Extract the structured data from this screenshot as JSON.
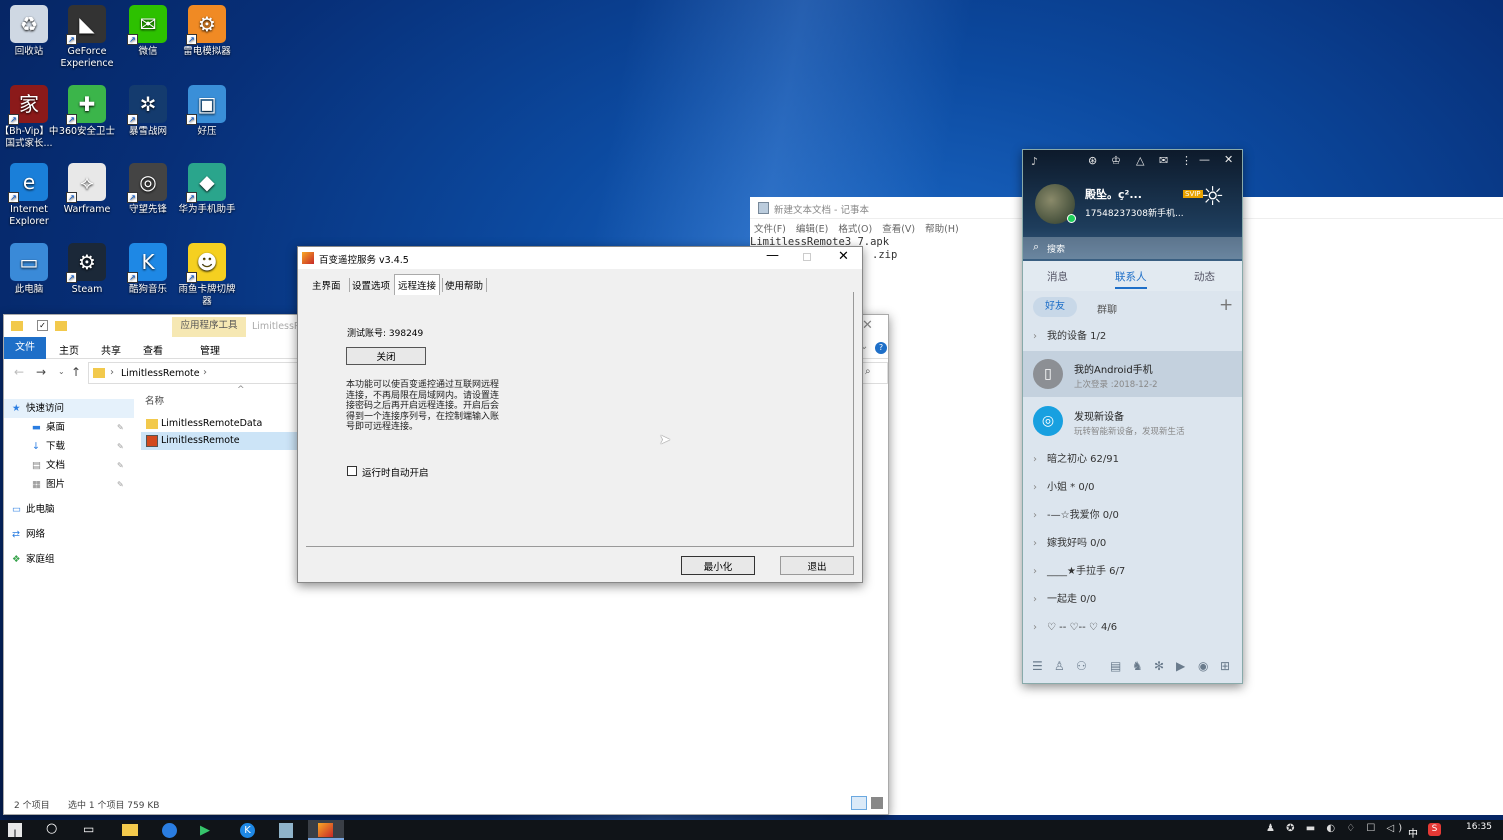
{
  "desktop": {
    "icons": [
      {
        "label": "回收站",
        "icon": "recycle-bin-icon",
        "bg": "#cfd8e3",
        "glyph": "♻"
      },
      {
        "label": "GeForce Experience",
        "icon": "geforce-icon",
        "bg": "#333333",
        "glyph": "◣"
      },
      {
        "label": "微信",
        "icon": "wechat-icon",
        "bg": "#2dc100",
        "glyph": "✉"
      },
      {
        "label": "雷电模拟器",
        "icon": "ldplayer-icon",
        "bg": "#f08a24",
        "glyph": "⚙"
      },
      {
        "label": "【Bh-Vip】中国式家长...",
        "icon": "game-icon",
        "bg": "#8b1a1a",
        "glyph": "家"
      },
      {
        "label": "360安全卫士",
        "icon": "360-icon",
        "bg": "#3bb54a",
        "glyph": "✚"
      },
      {
        "label": "暴雪战网",
        "icon": "battlenet-icon",
        "bg": "#143b6e",
        "glyph": "✲"
      },
      {
        "label": "好压",
        "icon": "haozip-icon",
        "bg": "#3a8fd8",
        "glyph": "▣"
      },
      {
        "label": "Internet Explorer",
        "icon": "ie-icon",
        "bg": "#1a7fd9",
        "glyph": "e"
      },
      {
        "label": "Warframe",
        "icon": "warframe-icon",
        "bg": "#e8e8e8",
        "glyph": "⟡"
      },
      {
        "label": "守望先锋",
        "icon": "overwatch-icon",
        "bg": "#444444",
        "glyph": "◎"
      },
      {
        "label": "华为手机助手",
        "icon": "hisuite-icon",
        "bg": "#2aa58c",
        "glyph": "◆"
      },
      {
        "label": "此电脑",
        "icon": "this-pc-icon",
        "bg": "#3a8ad8",
        "glyph": "▭"
      },
      {
        "label": "Steam",
        "icon": "steam-icon",
        "bg": "#1b2838",
        "glyph": "⚙"
      },
      {
        "label": "酷狗音乐",
        "icon": "kugou-icon",
        "bg": "#1e88e5",
        "glyph": "K"
      },
      {
        "label": "雨鱼卡牌切牌器",
        "icon": "pikachu-icon",
        "bg": "#f5d020",
        "glyph": "☻"
      }
    ]
  },
  "notepad": {
    "title": "新建文本文档 - 记事本",
    "menu": [
      "文件(F)",
      "编辑(E)",
      "格式(O)",
      "查看(V)",
      "帮助(H)"
    ],
    "line1": "LimitlessRemote3_7.apk",
    "line2": ".zip"
  },
  "explorer": {
    "ribbon_tabs": [
      "文件",
      "主页",
      "共享",
      "查看"
    ],
    "context_tab": "应用程序工具",
    "context_sub": "管理",
    "title_partial": "LimitlessR",
    "path": "LimitlessRemote",
    "nav": [
      {
        "label": "快速访问",
        "header": true
      },
      {
        "label": "桌面",
        "pin": true
      },
      {
        "label": "下载",
        "pin": true
      },
      {
        "label": "文档",
        "pin": true
      },
      {
        "label": "图片",
        "pin": true
      },
      {
        "label": "此电脑",
        "header": true
      },
      {
        "label": "网络",
        "header": true
      },
      {
        "label": "家庭组",
        "header": true
      }
    ],
    "col_name": "名称",
    "files": [
      {
        "name": "LimitlessRemoteData",
        "type": "folder"
      },
      {
        "name": "LimitlessRemote",
        "type": "app"
      }
    ],
    "status_count": "2 个项目",
    "status_sel": "选中 1 个项目 759 KB"
  },
  "dialog": {
    "title": "百变遥控服务 v3.4.5",
    "tabs": [
      "主界面",
      "设置选项",
      "远程连接",
      "使用帮助"
    ],
    "active_tab": 2,
    "account": "测试账号: 398249",
    "close_btn": "关闭",
    "desc": "本功能可以使百变遥控通过互联网远程连接，不再局限在局域网内。请设置连接密码之后再开启远程连接。开启后会得到一个连接序列号，在控制端输入账号即可远程连接。",
    "checkbox": "运行时自动开启",
    "minimize": "最小化",
    "exit": "退出"
  },
  "qq": {
    "nickname": "殿坠。ç²...",
    "vip": "SVIP",
    "sign": "17548237308新手机...",
    "search": "搜索",
    "tabs": [
      "消息",
      "联系人",
      "动态"
    ],
    "active_tab": 1,
    "subtabs": [
      "好友",
      "群聊"
    ],
    "devices_header": "我的设备 1/2",
    "device1_name": "我的Android手机",
    "device1_sub": "上次登录 :2018-12-2",
    "device2_name": "发现新设备",
    "device2_sub": "玩转智能新设备，发现新生活",
    "groups": [
      "暗之初心 62/91",
      "小姐 * 0/0",
      "-—☆我爱你 0/0",
      "嫁我好吗 0/0",
      "____★手拉手 6/7",
      "一起走 0/0",
      "♡ -- ♡-- ♡ 4/6"
    ]
  },
  "taskbar": {
    "time": "16:35",
    "ime": "中",
    "apps": [
      "search-icon",
      "task-view-icon",
      "file-explorer-icon",
      "browser-icon",
      "ldplayer-icon",
      "kugou-icon",
      "notepad-icon",
      "remote-app-icon"
    ]
  }
}
